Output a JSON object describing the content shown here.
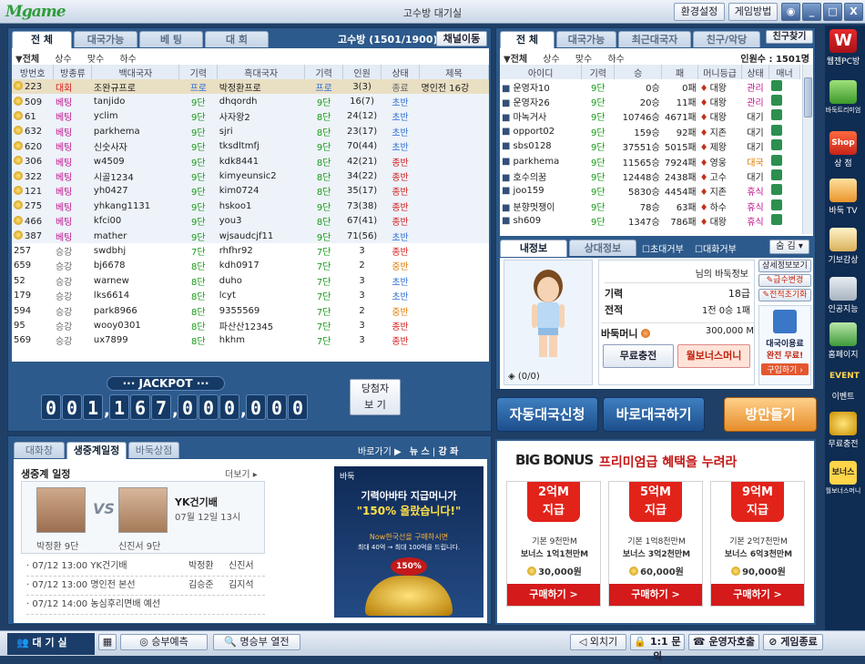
{
  "app": {
    "logo": "Mgame",
    "title": "고수방 대기실"
  },
  "titlebar": {
    "buttons": [
      "환경설정",
      "게임방법"
    ]
  },
  "room": {
    "tabs": [
      "전  체",
      "대국가능",
      "베  팅",
      "대  회"
    ],
    "label": "고수방",
    "count": "(1501/1900)",
    "channel_btn": "채널이동",
    "filters": [
      "▼전체",
      "상수",
      "맞수",
      "하수"
    ],
    "columns": [
      "방번호",
      "방종류",
      "백대국자",
      "기력",
      "흑대국자",
      "기력",
      "인원",
      "상태",
      "제목"
    ],
    "rows": [
      [
        "223",
        "대회",
        "조완규프로",
        "프로",
        "박정환프로",
        "프로",
        "3(3)",
        "종료",
        "명인전 16강"
      ],
      [
        "509",
        "베팅",
        "tanjido",
        "9단",
        "dhqordh",
        "9단",
        "16(7)",
        "초반",
        ""
      ],
      [
        "61",
        "베팅",
        "yclim",
        "9단",
        "사자왕2",
        "8단",
        "24(12)",
        "초반",
        ""
      ],
      [
        "632",
        "베팅",
        "parkhema",
        "9단",
        "sjri",
        "8단",
        "23(17)",
        "초반",
        ""
      ],
      [
        "620",
        "베팅",
        "신숫사자",
        "9단",
        "tksdltmfj",
        "9단",
        "70(44)",
        "초반",
        ""
      ],
      [
        "306",
        "베팅",
        "w4509",
        "9단",
        "kdk8441",
        "8단",
        "42(21)",
        "종반",
        ""
      ],
      [
        "322",
        "베팅",
        "시골1234",
        "9단",
        "kimyeunsic2",
        "8단",
        "34(22)",
        "종반",
        ""
      ],
      [
        "121",
        "베팅",
        "yh0427",
        "9단",
        "kim0724",
        "8단",
        "35(17)",
        "종반",
        ""
      ],
      [
        "275",
        "베팅",
        "yhkang1131",
        "9단",
        "hskoo1",
        "9단",
        "73(38)",
        "종반",
        ""
      ],
      [
        "466",
        "베팅",
        "kfci00",
        "9단",
        "you3",
        "8단",
        "67(41)",
        "종반",
        ""
      ],
      [
        "387",
        "베팅",
        "mather",
        "9단",
        "wjsaudcjf11",
        "9단",
        "71(56)",
        "초반",
        ""
      ],
      [
        "257",
        "승강",
        "swdbhj",
        "7단",
        "rhfhr92",
        "7단",
        "3",
        "종반",
        ""
      ],
      [
        "659",
        "승강",
        "bj6678",
        "8단",
        "kdh0917",
        "7단",
        "2",
        "중반",
        ""
      ],
      [
        "52",
        "승강",
        "warnew",
        "8단",
        "duho",
        "7단",
        "3",
        "초반",
        ""
      ],
      [
        "179",
        "승강",
        "lks6614",
        "8단",
        "lcyt",
        "7단",
        "3",
        "초반",
        ""
      ],
      [
        "594",
        "승강",
        "park8966",
        "8단",
        "9355569",
        "7단",
        "2",
        "중반",
        ""
      ],
      [
        "95",
        "승강",
        "wooy0301",
        "8단",
        "파산산12345",
        "7단",
        "3",
        "종반",
        ""
      ],
      [
        "569",
        "승강",
        "ux7899",
        "8단",
        "hkhm",
        "7단",
        "3",
        "종반",
        ""
      ]
    ]
  },
  "jackpot": {
    "label": "··· JACKPOT ···",
    "digits": [
      "0",
      "0",
      "1",
      "1",
      "6",
      "7",
      "0",
      "0",
      "0",
      "0",
      "0",
      "0"
    ],
    "winner_btn_line1": "당첨자",
    "winner_btn_line2": "보 기"
  },
  "users": {
    "tabs": [
      "전  체",
      "대국가능",
      "최근대국자",
      "친구/악당"
    ],
    "find_btn": "친구찾기",
    "count_label": "인원수 : 1501명",
    "filters": [
      "▼전체",
      "상수",
      "맞수",
      "하수"
    ],
    "columns": [
      "아이디",
      "기력",
      "승",
      "패",
      "머니등급",
      "상태",
      "매너"
    ],
    "rows": [
      [
        "운영자10",
        "9단",
        "0승",
        "0패",
        "대왕",
        "관리"
      ],
      [
        "운영자26",
        "9단",
        "20승",
        "11패",
        "대왕",
        "관리"
      ],
      [
        "마녹거사",
        "9단",
        "10746승",
        "4671패",
        "대왕",
        "대기"
      ],
      [
        "opport02",
        "9단",
        "159승",
        "92패",
        "지존",
        "대기"
      ],
      [
        "sbs0128",
        "9단",
        "37551승",
        "5015패",
        "제왕",
        "대기"
      ],
      [
        "parkhema",
        "9단",
        "11565승",
        "7924패",
        "영웅",
        "대국"
      ],
      [
        "호수의꿈",
        "9단",
        "12448승",
        "2438패",
        "고수",
        "대기"
      ],
      [
        "joo159",
        "9단",
        "5830승",
        "4454패",
        "지존",
        "휴식"
      ],
      [
        "분향멋쟁이",
        "9단",
        "78승",
        "63패",
        "하수",
        "휴식"
      ],
      [
        "sh609",
        "9단",
        "1347승",
        "786패",
        "대왕",
        "휴식"
      ]
    ]
  },
  "myinfo": {
    "tabs": [
      "내정보",
      "상대정보"
    ],
    "checks": [
      "초대거부",
      "대화거부"
    ],
    "hide_btn": "숨 김",
    "title": "님의 바둑정보",
    "rank_label": "기력",
    "rank": "18급",
    "record_label": "전적",
    "record": "1전 0승 1패",
    "money_label": "바둑머니",
    "money": "300,000 M",
    "recharge_btn": "무료충전",
    "bonus_btn": "월보너스머니",
    "detail_btn": "상세정보보기",
    "rankchange_btn": "급수변경",
    "reset_btn": "전적초기화",
    "counter": "(0/0)",
    "ad_line1": "대국이용료",
    "ad_line2": "완전 무료!",
    "ad_btn": "구입하기"
  },
  "actions": {
    "auto": "자동대국신청",
    "direct": "바로대국하기",
    "create": "방만들기"
  },
  "news": {
    "tabs": [
      "대화창",
      "생중계일정",
      "바둑상점"
    ],
    "shortcut": "바로가기 ▶",
    "links": [
      "뉴 스",
      "강 좌"
    ],
    "heading": "생중계 일정",
    "more": "더보기 ▸",
    "match_title": "YK건기배",
    "match_date": "07월 12일 13시",
    "vs": "VS",
    "p1": "박정환 9단",
    "p2": "신진서 9단",
    "schedule": [
      [
        "· 07/12 13:00 YK건기배",
        "박정환",
        "신진서"
      ],
      [
        "· 07/12 13:00 명인전 본선",
        "김승준",
        "김지석"
      ],
      [
        "· 07/12 14:00 농심후리면배 예선",
        "",
        ""
      ]
    ],
    "ad_logo": "바둑",
    "ad_line1": "기력아바타 지급머니가",
    "ad_line2": "\"150% 올랐습니다!\"",
    "ad_line3": "Now한국선을 구매하시면",
    "ad_line4": "최대 40억 → 최대 100억을 드립니다.",
    "ad_badge": "150%"
  },
  "bigbonus": {
    "title1": "BIG BONUS",
    "title2": "프리미엄급 혜택을 누려라",
    "cards": [
      {
        "ribbon": "2억M",
        "ribbon2": "지급",
        "base": "기본 9천만M",
        "bonus": "보너스 1억1천만M",
        "price": "30,000원",
        "buy": "구매하기 >"
      },
      {
        "ribbon": "5억M",
        "ribbon2": "지급",
        "base": "기본 1억8천만M",
        "bonus": "보너스 3억2천만M",
        "price": "60,000원",
        "buy": "구매하기 >"
      },
      {
        "ribbon": "9억M",
        "ribbon2": "지급",
        "base": "기본 2억7천만M",
        "bonus": "보너스 6억3천만M",
        "price": "90,000원",
        "buy": "구매하기 >"
      }
    ]
  },
  "sidebar": [
    "웹젠PC방",
    "바둑트리미엄",
    "상 점",
    "바둑 TV",
    "기보감상",
    "인공지능",
    "홈페이지",
    "이벤트",
    "무료충전",
    "월보너스머니"
  ],
  "sidebar_icon_text": {
    "shop": "Shop",
    "event": "EVENT",
    "bonus": "보너스",
    "wz": "W"
  },
  "bottombar": {
    "lobby": "대 기 실",
    "predict": "승부예측",
    "hall": "명승부 열전",
    "kick": "외치기",
    "inquiry": "1:1 문의",
    "operator": "운영자호출",
    "exit": "게임종료"
  }
}
